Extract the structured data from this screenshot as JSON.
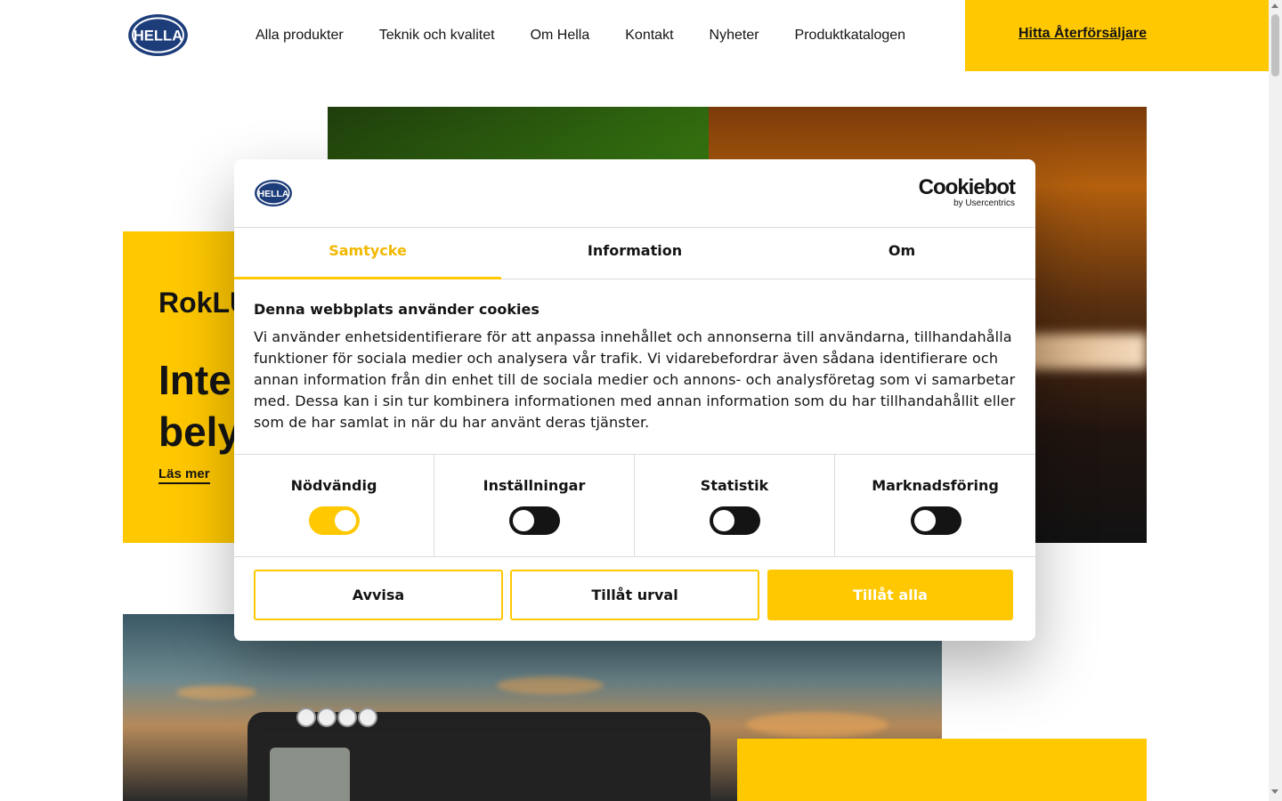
{
  "header": {
    "logo_text": "HELLA",
    "nav": [
      "Alla produkter",
      "Teknik och kvalitet",
      "Om Hella",
      "Kontakt",
      "Nyheter",
      "Produktkatalogen"
    ],
    "dealer_link": "Hitta Återförsäljare",
    "accent_color": "#ffc800"
  },
  "hero": {
    "eyebrow": "RokLU",
    "headline": "Inte\nbely",
    "more_link": "Läs mer"
  },
  "cookie_dialog": {
    "logo_text": "HELLA",
    "brand_name": "Cookiebot",
    "brand_sub": "by Usercentrics",
    "tabs": [
      "Samtycke",
      "Information",
      "Om"
    ],
    "active_tab": "Samtycke",
    "title": "Denna webbplats använder cookies",
    "text": "Vi använder enhetsidentifierare för att anpassa innehållet och annonserna till användarna, tillhandahålla funktioner för sociala medier och analysera vår trafik. Vi vidarebefordrar även sådana identifierare och annan information från din enhet till de sociala medier och annons- och analysföretag som vi samarbetar med. Dessa kan i sin tur kombinera informationen med annan information som du har tillhandahållit eller som de har samlat in när du har använt deras tjänster.",
    "categories": [
      {
        "label": "Nödvändig",
        "enabled": true
      },
      {
        "label": "Inställningar",
        "enabled": false
      },
      {
        "label": "Statistik",
        "enabled": false
      },
      {
        "label": "Marknadsföring",
        "enabled": false
      }
    ],
    "buttons": {
      "reject": "Avvisa",
      "allow_selection": "Tillåt urval",
      "allow_all": "Tillåt alla"
    }
  }
}
